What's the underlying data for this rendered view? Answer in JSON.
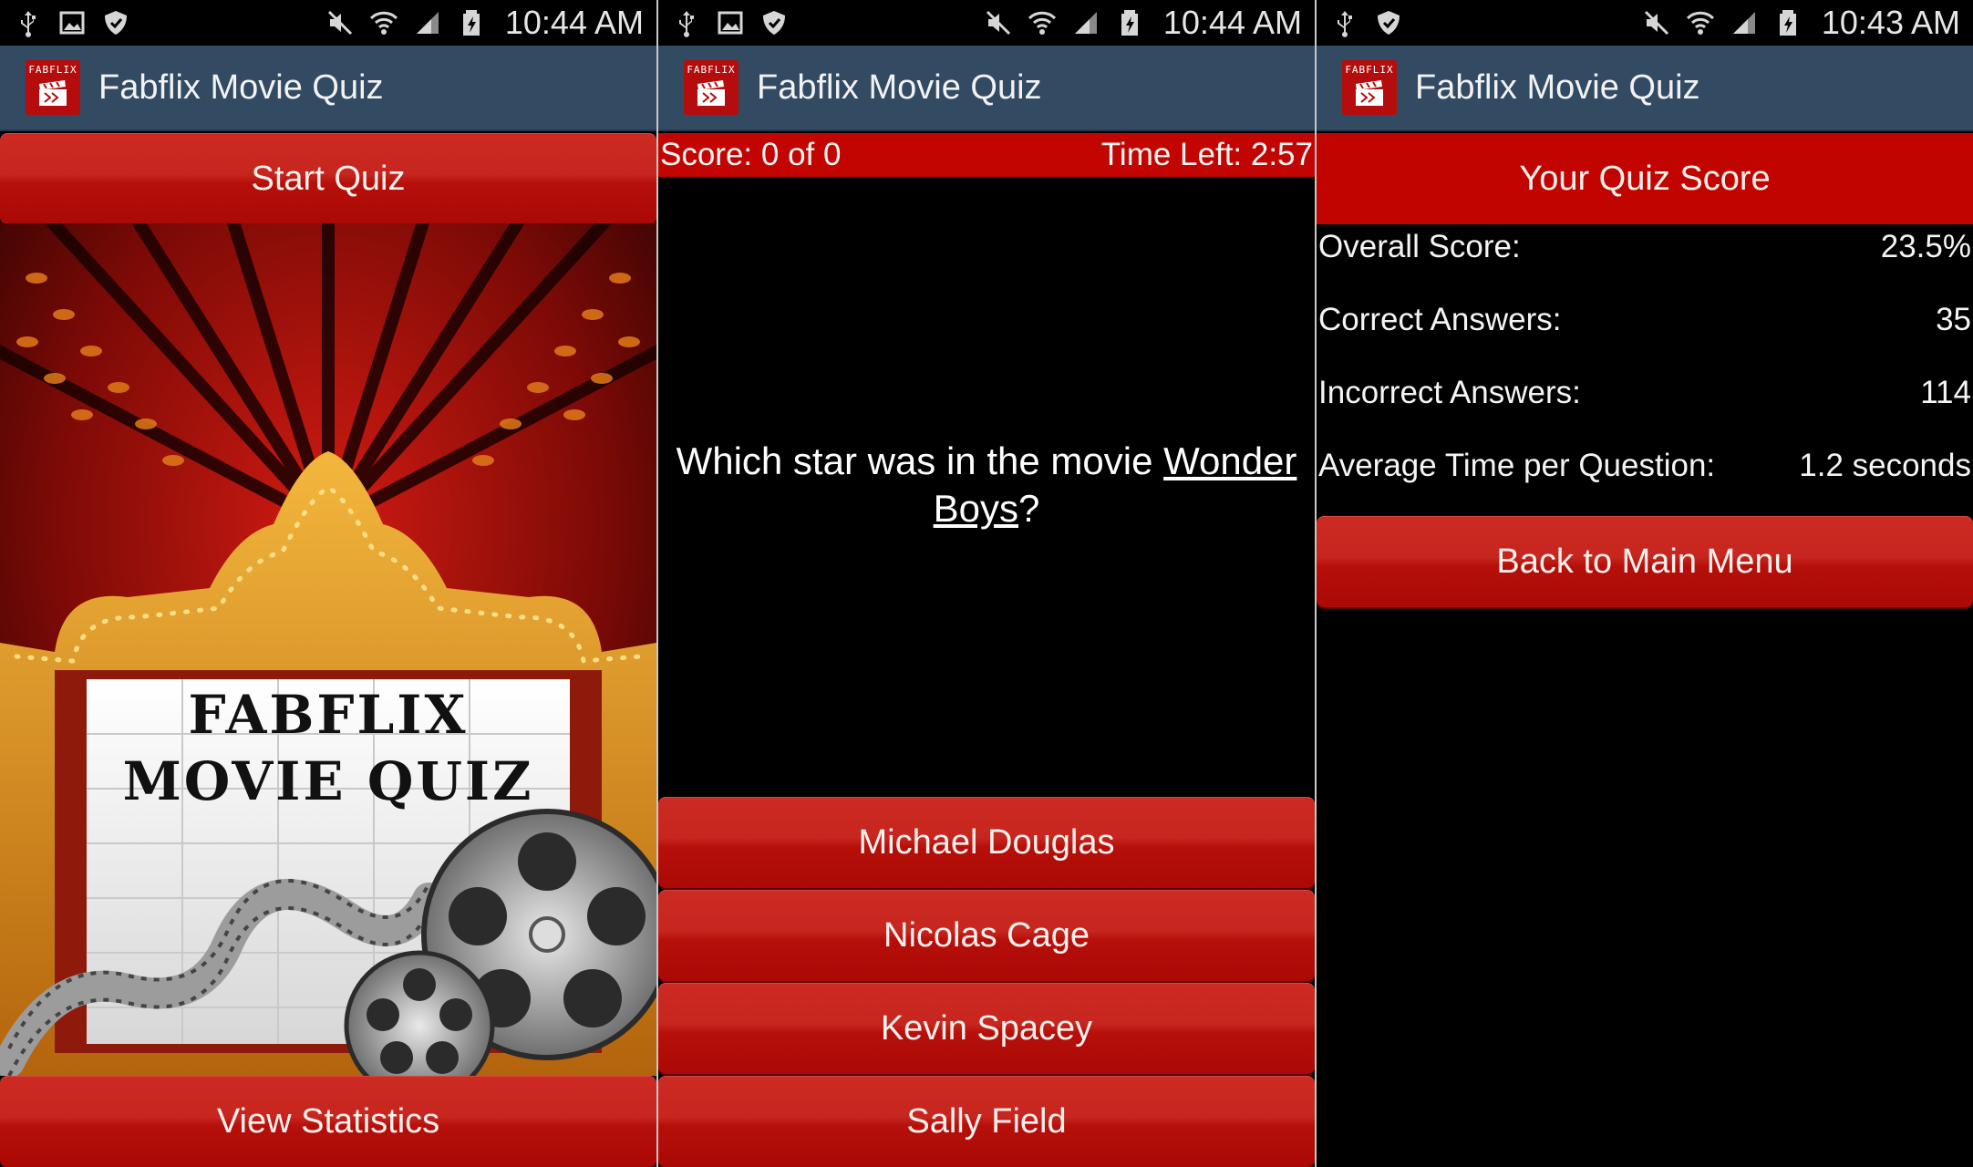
{
  "app": {
    "title": "Fabflix Movie Quiz",
    "logo_text": "FABFLIX"
  },
  "colors": {
    "action_bar": "#324b63",
    "button_red": "#c10400",
    "background": "#000000"
  },
  "screens": [
    {
      "status": {
        "time": "10:44 AM",
        "left_icons": [
          "usb-icon",
          "image-icon",
          "shield-icon"
        ],
        "right_icons": [
          "mute-icon",
          "wifi-icon",
          "signal-icon",
          "battery-icon"
        ]
      },
      "start_button": "Start Quiz",
      "poster": {
        "line1": "FABFLIX",
        "line2": "MOVIE QUIZ"
      },
      "stats_button": "View Statistics"
    },
    {
      "status": {
        "time": "10:44 AM",
        "left_icons": [
          "usb-icon",
          "image-icon",
          "shield-icon"
        ],
        "right_icons": [
          "mute-icon",
          "wifi-icon",
          "signal-icon",
          "battery-icon"
        ]
      },
      "score": "Score: 0 of 0",
      "time_left": "Time Left: 2:57",
      "question_prefix": "Which star was in the movie ",
      "question_movie": "Wonder Boys",
      "question_suffix": "?",
      "answers": [
        "Michael Douglas",
        "Nicolas Cage",
        "Kevin Spacey",
        "Sally Field"
      ]
    },
    {
      "status": {
        "time": "10:43 AM",
        "left_icons": [
          "usb-icon",
          "shield-icon"
        ],
        "right_icons": [
          "mute-icon",
          "wifi-icon",
          "signal-icon",
          "battery-icon"
        ]
      },
      "header": "Your Quiz Score",
      "stats": [
        {
          "label": "Overall Score:",
          "value": "23.5%"
        },
        {
          "label": "Correct Answers:",
          "value": "35"
        },
        {
          "label": "Incorrect Answers:",
          "value": "114"
        },
        {
          "label": "Average Time per Question:",
          "value": "1.2 seconds"
        }
      ],
      "back_button": "Back to Main Menu"
    }
  ]
}
